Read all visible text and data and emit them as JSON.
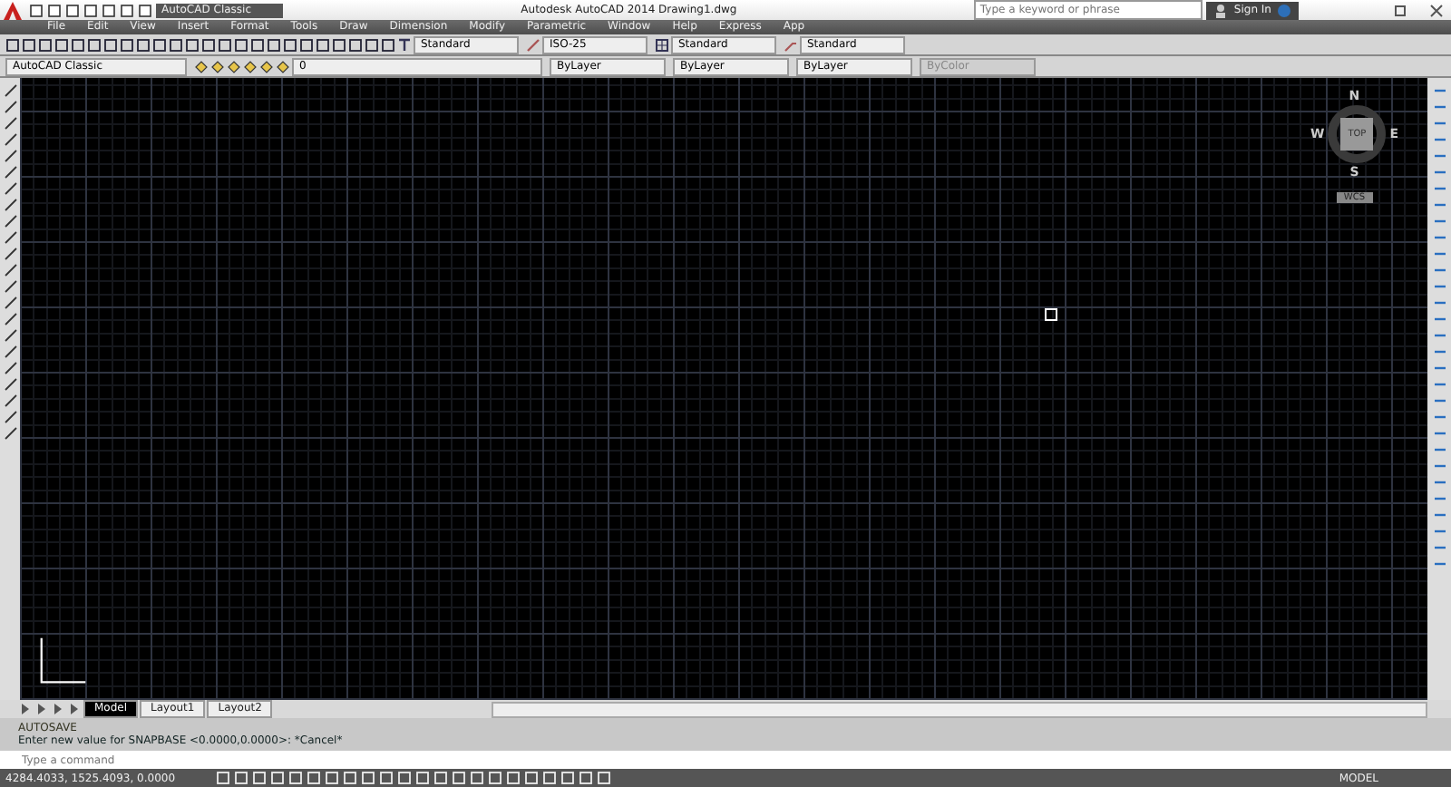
{
  "window": {
    "title": "Autodesk AutoCAD 2014    Drawing1.dwg",
    "workspace": "AutoCAD Classic"
  },
  "search": {
    "placeholder": "Type a keyword or phrase"
  },
  "sign_in": "Sign In",
  "menu": [
    "File",
    "Edit",
    "View",
    "Insert",
    "Format",
    "Tools",
    "Draw",
    "Dimension",
    "Modify",
    "Parametric",
    "Window",
    "Help",
    "Express",
    "App"
  ],
  "styles_toolbar": [
    {
      "kind": "text",
      "value": "Standard"
    },
    {
      "kind": "dim",
      "value": "ISO-25"
    },
    {
      "kind": "table",
      "value": "Standard"
    },
    {
      "kind": "mleader",
      "value": "Standard"
    }
  ],
  "layers_toolbar": {
    "workspace": "AutoCAD Classic",
    "layer": "0",
    "color_control": "ByLayer",
    "linetype": "ByLayer",
    "lineweight": "ByLayer",
    "plotstyle": "ByColor"
  },
  "viewcube": {
    "north": "N",
    "south": "S",
    "east": "E",
    "west": "W",
    "face": "TOP",
    "ucs": "WCS"
  },
  "layout_tabs": [
    {
      "label": "Model",
      "selected": true
    },
    {
      "label": "Layout1",
      "selected": false
    },
    {
      "label": "Layout2",
      "selected": false
    }
  ],
  "command_history": [
    "AUTOSAVE",
    "Enter new value for SNAPBASE <0.0000,0.0000>: *Cancel*"
  ],
  "command_line": {
    "placeholder": "Type a command"
  },
  "status_bar": {
    "coordinates": "4284.4033, 1525.4093, 0.0000",
    "space": "MODEL"
  }
}
